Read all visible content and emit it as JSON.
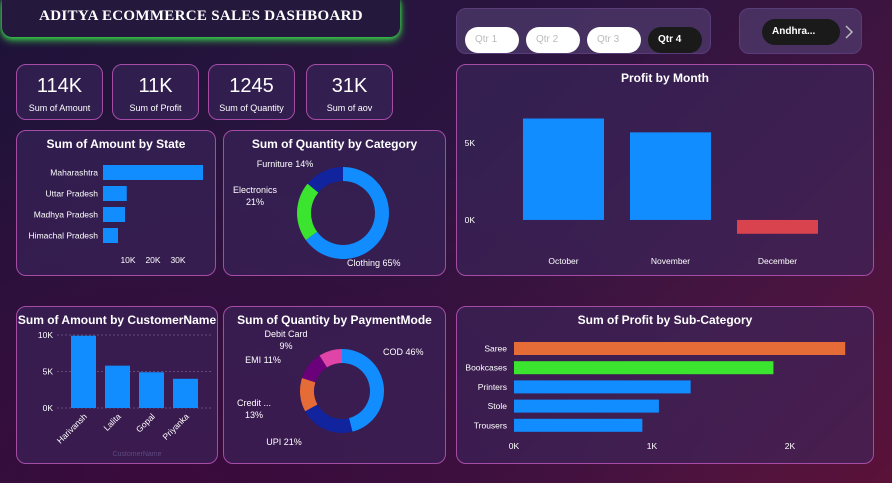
{
  "title": "ADITYA ECOMMERCE SALES DASHBOARD",
  "kpis": [
    {
      "value": "114K",
      "label": "Sum of Amount"
    },
    {
      "value": "11K",
      "label": "Sum of Profit"
    },
    {
      "value": "1245",
      "label": "Sum of Quantity"
    },
    {
      "value": "31K",
      "label": "Sum of aov"
    }
  ],
  "quarter_slicer": {
    "options": [
      "Qtr 1",
      "Qtr 2",
      "Qtr 3",
      "Qtr 4"
    ],
    "selected": "Qtr 4"
  },
  "state_slicer": {
    "value": "Andhra...",
    "arrow": "chevron-right-icon"
  },
  "colors": {
    "blue": "#118dff",
    "orange": "#e66c37",
    "green": "#3ae42f",
    "red": "#d9434e",
    "navy": "#12239e",
    "purple": "#6b007b",
    "pink": "#e044a7",
    "border": "#a64ca6"
  },
  "chart_data": [
    {
      "id": "amount_by_state",
      "type": "bar",
      "orientation": "horizontal",
      "title": "Sum of Amount by State",
      "categories": [
        "Maharashtra",
        "Uttar Pradesh",
        "Madhya Pradesh",
        "Himachal Pradesh"
      ],
      "values": [
        40000,
        9500,
        8800,
        6000
      ],
      "xticks": [
        "10K",
        "20K",
        "30K"
      ],
      "xtick_values": [
        10000,
        20000,
        30000
      ],
      "xlim": [
        0,
        40000
      ]
    },
    {
      "id": "quantity_by_category",
      "type": "pie",
      "donut": true,
      "title": "Sum of Quantity by Category",
      "categories": [
        "Clothing",
        "Electronics",
        "Furniture"
      ],
      "values": [
        65,
        21,
        14
      ],
      "labels": [
        [
          "Clothing 65%"
        ],
        [
          "Electronics",
          "21%"
        ],
        [
          "Furniture 14%"
        ]
      ]
    },
    {
      "id": "profit_by_month",
      "type": "bar",
      "title": "Profit by Month",
      "categories": [
        "October",
        "November",
        "December"
      ],
      "values": [
        6600,
        5700,
        -900
      ],
      "yticks": [
        "5K",
        "0K"
      ],
      "ytick_values": [
        5000,
        0
      ],
      "ylim": [
        -1500,
        8000
      ]
    },
    {
      "id": "amount_by_customer",
      "type": "bar",
      "title": "Sum of Amount by CustomerName",
      "categories": [
        "Harivansh",
        "Lalita",
        "Gopal",
        "Priyanka"
      ],
      "values": [
        9900,
        5800,
        4900,
        4000
      ],
      "yticks": [
        "10K",
        "5K",
        "0K"
      ],
      "ytick_values": [
        10000,
        5000,
        0
      ],
      "ylim": [
        0,
        10000
      ],
      "xlabel": "CustomerName"
    },
    {
      "id": "quantity_by_paymentmode",
      "type": "pie",
      "donut": true,
      "title": "Sum of Quantity by PaymentMode",
      "categories": [
        "COD",
        "UPI",
        "Credit ...",
        "EMI",
        "Debit Card"
      ],
      "values": [
        46,
        21,
        13,
        11,
        9
      ],
      "labels": [
        [
          "COD 46%"
        ],
        [
          "UPI 21%"
        ],
        [
          "Credit ...",
          "13%"
        ],
        [
          "EMI 11%"
        ],
        [
          "Debit Card",
          "9%"
        ]
      ]
    },
    {
      "id": "profit_by_subcategory",
      "type": "bar",
      "orientation": "horizontal",
      "title": "Sum of Profit by Sub-Category",
      "categories": [
        "Saree",
        "Bookcases",
        "Printers",
        "Stole",
        "Trousers"
      ],
      "values": [
        2400,
        1880,
        1280,
        1050,
        930
      ],
      "xticks": [
        "0K",
        "1K",
        "2K"
      ],
      "xtick_values": [
        0,
        1000,
        2000
      ],
      "xlim": [
        0,
        2500
      ]
    }
  ]
}
